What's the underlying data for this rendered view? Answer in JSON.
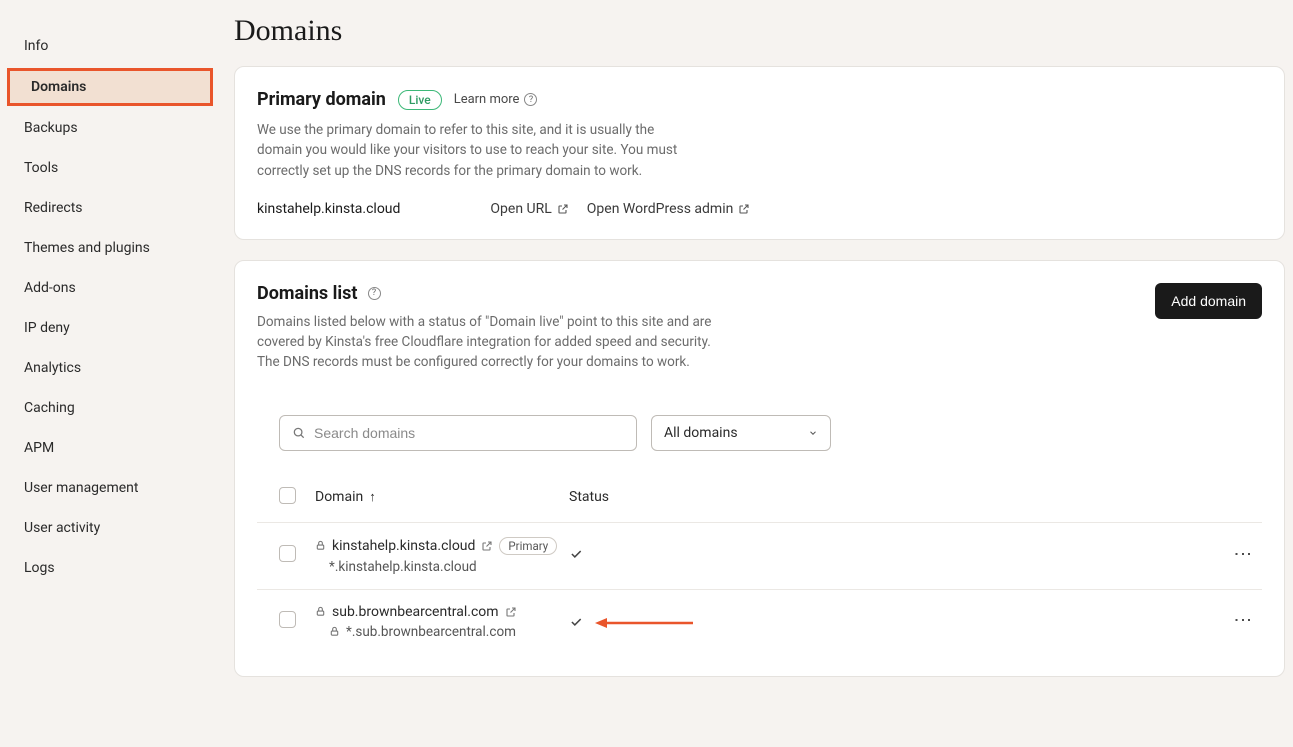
{
  "sidebar": {
    "items": [
      {
        "label": "Info"
      },
      {
        "label": "Domains"
      },
      {
        "label": "Backups"
      },
      {
        "label": "Tools"
      },
      {
        "label": "Redirects"
      },
      {
        "label": "Themes and plugins"
      },
      {
        "label": "Add-ons"
      },
      {
        "label": "IP deny"
      },
      {
        "label": "Analytics"
      },
      {
        "label": "Caching"
      },
      {
        "label": "APM"
      },
      {
        "label": "User management"
      },
      {
        "label": "User activity"
      },
      {
        "label": "Logs"
      }
    ],
    "activeIndex": 1
  },
  "page": {
    "title": "Domains"
  },
  "primary": {
    "heading": "Primary domain",
    "badge": "Live",
    "learn_more": "Learn more",
    "description": "We use the primary domain to refer to this site, and it is usually the domain you would like your visitors to use to reach your site. You must correctly set up the DNS records for the primary domain to work.",
    "domain": "kinstahelp.kinsta.cloud",
    "open_url": "Open URL",
    "open_wp": "Open WordPress admin"
  },
  "list": {
    "heading": "Domains list",
    "description": "Domains listed below with a status of \"Domain live\" point to this site and are covered by Kinsta's free Cloudflare integration for added speed and security. The DNS records must be configured correctly for your domains to work.",
    "add_button": "Add domain",
    "search_placeholder": "Search domains",
    "filter_selected": "All domains",
    "columns": {
      "domain": "Domain",
      "status": "Status"
    },
    "rows": [
      {
        "domain": "kinstahelp.kinsta.cloud",
        "wildcard": "*.kinstahelp.kinsta.cloud",
        "primary_badge": "Primary",
        "wildcard_lock": false
      },
      {
        "domain": "sub.brownbearcentral.com",
        "wildcard": "*.sub.brownbearcentral.com",
        "primary_badge": null,
        "wildcard_lock": true
      }
    ]
  }
}
